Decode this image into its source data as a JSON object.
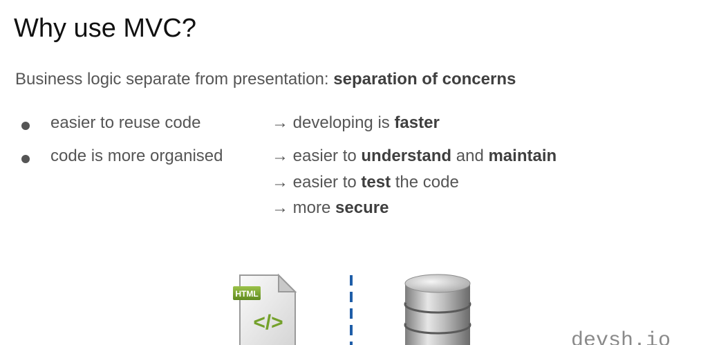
{
  "slide": {
    "title": "Why use MVC?",
    "intro": {
      "text": "Business logic separate from presentation: ",
      "bold": "separation of concerns"
    },
    "bullets": [
      {
        "label": "easier to reuse code",
        "points": [
          {
            "arrow": "→",
            "pre": "developing is ",
            "bold1": "faster",
            "mid": "",
            "bold2": "",
            "post": ""
          }
        ]
      },
      {
        "label": "code is more organised",
        "points": [
          {
            "arrow": "→",
            "pre": "easier to ",
            "bold1": "understand",
            "mid": " and ",
            "bold2": "maintain",
            "post": ""
          },
          {
            "arrow": "→",
            "pre": "easier to ",
            "bold1": "test",
            "mid": "",
            "bold2": "",
            "post": " the code"
          },
          {
            "arrow": "→",
            "pre": "more ",
            "bold1": "secure",
            "mid": "",
            "bold2": "",
            "post": ""
          }
        ]
      }
    ],
    "html_icon_badge": "HTML",
    "html_icon_symbol": "</>",
    "watermark": "devsh.io"
  },
  "colors": {
    "title": "#111111",
    "text": "#555555",
    "divider": "#1f5ea8",
    "html_green": "#7ea82f",
    "db_gray": "#9a9a9a"
  },
  "icons": [
    "html-file-icon",
    "database-icon"
  ]
}
